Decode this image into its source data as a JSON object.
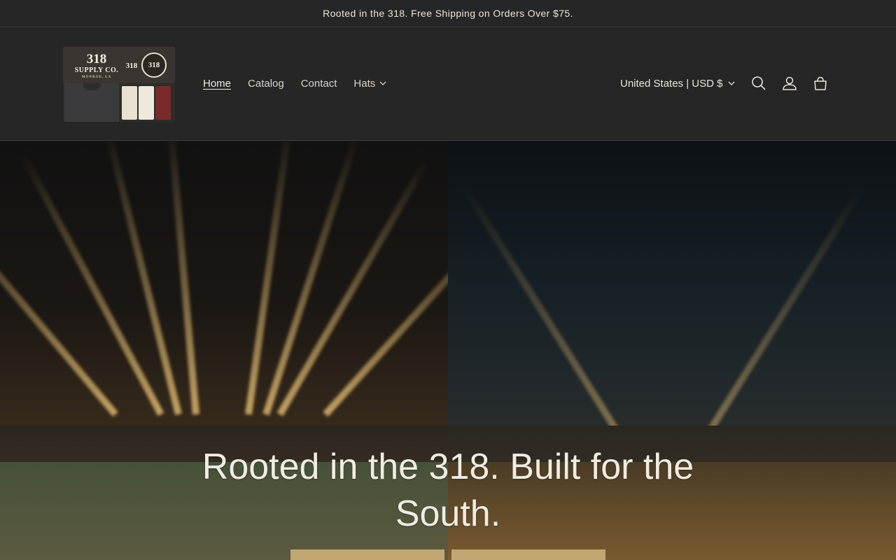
{
  "announcement": {
    "text": "Rooted in the 318. Free Shipping on Orders Over $75."
  },
  "logo": {
    "line1": "318",
    "line2": "SUPPLY CO.",
    "line3": "MONROE, LA",
    "seal_text": "318"
  },
  "nav": {
    "items": [
      {
        "label": "Home"
      },
      {
        "label": "Catalog"
      },
      {
        "label": "Contact"
      },
      {
        "label": "Hats"
      }
    ]
  },
  "region": {
    "label": "United States | USD $"
  },
  "icons": {
    "search": "search-icon",
    "account": "account-icon",
    "cart": "cart-icon",
    "chevron": "chevron-down-icon"
  },
  "hero": {
    "title": "Rooted in the 318. Built for the South."
  },
  "colors": {
    "background": "#262626",
    "accent": "#c3a773",
    "text": "#ece6da"
  }
}
